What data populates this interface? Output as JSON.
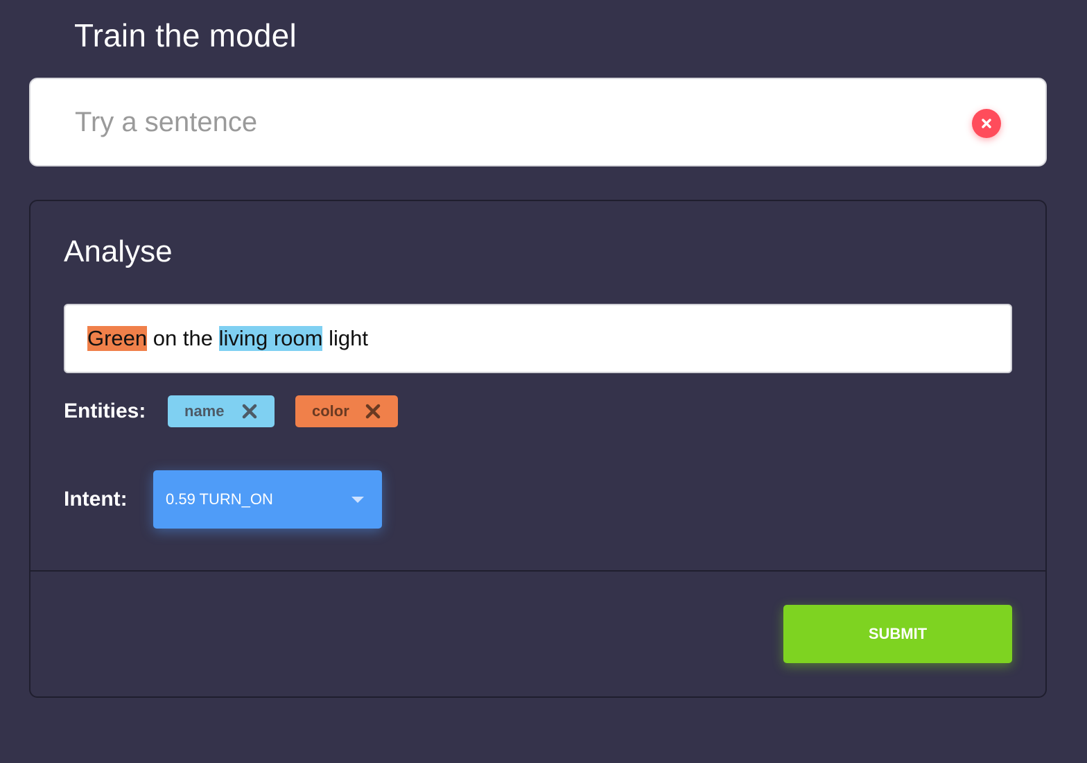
{
  "page_title": "Train the model",
  "try_input": {
    "placeholder": "Try a sentence",
    "value": "",
    "clear_icon": "close-circle-icon",
    "clear_color": "#ff4c5b"
  },
  "analyse": {
    "title": "Analyse",
    "sentence": {
      "segments": [
        {
          "text": "Green",
          "entity": "color"
        },
        {
          "text": " on the ",
          "entity": ""
        },
        {
          "text": "living room",
          "entity": "name"
        },
        {
          "text": " light",
          "entity": ""
        }
      ]
    },
    "entities_label": "Entities:",
    "entities": [
      {
        "label": "name",
        "color": "#7fd0f2",
        "remove_icon": "close-icon"
      },
      {
        "label": "color",
        "color": "#f0804a",
        "remove_icon": "close-icon"
      }
    ],
    "intent_label": "Intent:",
    "intent": {
      "selected": "0.59 TURN_ON",
      "icon": "chevron-down-icon",
      "color": "#4f9cf8"
    },
    "submit_label": "SUBMIT",
    "submit_color": "#7ed321"
  },
  "colors": {
    "background": "#35334b",
    "panel_border": "#1f1e2e"
  }
}
